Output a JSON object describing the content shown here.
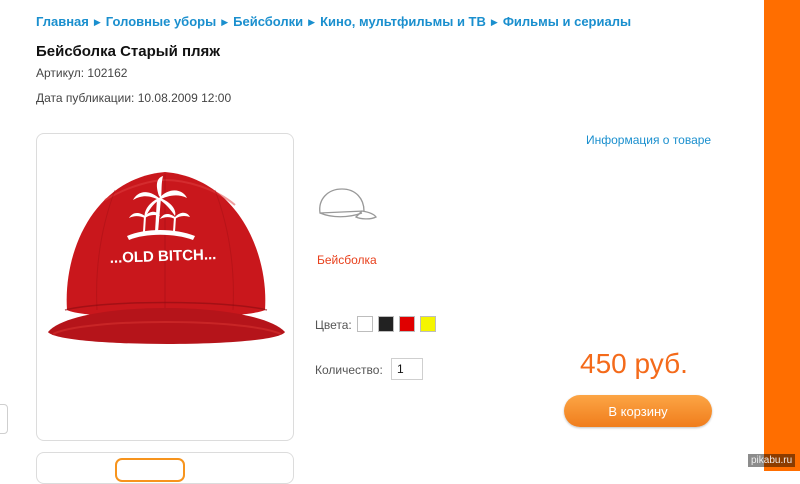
{
  "theme": {
    "accent": "#f46a1a",
    "link": "#1a8fce",
    "side_strip": "#ff6e00"
  },
  "breadcrumb": [
    "Главная",
    "Головные уборы",
    "Бейсболки",
    "Кино, мультфильмы и ТВ",
    "Фильмы и сериалы"
  ],
  "product": {
    "title": "Бейсболка Старый пляж",
    "article": "Артикул: 102162",
    "published": "Дата публикации: 10.08.2009 12:00",
    "print_text": "...OLD BITCH..."
  },
  "info_link": "Информация о товаре",
  "product_type": {
    "label": "Бейсболка",
    "icon": "cap-outline-icon"
  },
  "colors": {
    "label": "Цвета:",
    "options": [
      "#ffffff",
      "#222222",
      "#e00000",
      "#f5f500"
    ]
  },
  "quantity": {
    "label": "Количество:",
    "value": "1"
  },
  "price": "450 руб.",
  "cart_button": "В корзину",
  "watermark": "pikabu.ru"
}
